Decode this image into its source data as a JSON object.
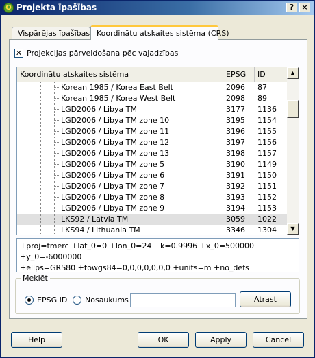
{
  "window": {
    "title": "Projekta īpašības",
    "help_glyph": "?",
    "close_glyph": "×",
    "icon": "qgis-icon"
  },
  "tabs": [
    {
      "label": "Vispārējas īpašības",
      "active": false
    },
    {
      "label": "Koordinātu atskaites sistēma (CRS)",
      "active": true
    }
  ],
  "reprojection": {
    "label": "Projekcijas pārveidošana pēc vajadzības",
    "checked": true,
    "check_glyph": "✕"
  },
  "crs_table": {
    "columns": [
      "Koordinātu atskaites sistēma",
      "EPSG",
      "ID"
    ],
    "rows": [
      {
        "name": "Korean 1985 / Korea East Belt",
        "epsg": "2096",
        "id": "87"
      },
      {
        "name": "Korean 1985 / Korea West Belt",
        "epsg": "2098",
        "id": "89"
      },
      {
        "name": "LGD2006 / Libya TM",
        "epsg": "3177",
        "id": "1136"
      },
      {
        "name": "LGD2006 / Libya TM zone 10",
        "epsg": "3195",
        "id": "1154"
      },
      {
        "name": "LGD2006 / Libya TM zone 11",
        "epsg": "3196",
        "id": "1155"
      },
      {
        "name": "LGD2006 / Libya TM zone 12",
        "epsg": "3197",
        "id": "1156"
      },
      {
        "name": "LGD2006 / Libya TM zone 13",
        "epsg": "3198",
        "id": "1157"
      },
      {
        "name": "LGD2006 / Libya TM zone 5",
        "epsg": "3190",
        "id": "1149"
      },
      {
        "name": "LGD2006 / Libya TM zone 6",
        "epsg": "3191",
        "id": "1150"
      },
      {
        "name": "LGD2006 / Libya TM zone 7",
        "epsg": "3192",
        "id": "1151"
      },
      {
        "name": "LGD2006 / Libya TM zone 8",
        "epsg": "3193",
        "id": "1152"
      },
      {
        "name": "LGD2006 / Libya TM zone 9",
        "epsg": "3194",
        "id": "1153"
      },
      {
        "name": "LKS92 / Latvia TM",
        "epsg": "3059",
        "id": "1022"
      },
      {
        "name": "LKS94 / Lithuania TM",
        "epsg": "3346",
        "id": "1304"
      }
    ],
    "selected_row": "LKS92 / Latvia TM"
  },
  "proj_string": "+proj=tmerc +lat_0=0 +lon_0=24 +k=0.9996 +x_0=500000 +y_0=-6000000\n+ellps=GRS80 +towgs84=0,0,0,0,0,0,0 +units=m +no_defs",
  "search": {
    "group_title": "Meklēt",
    "option_epsg": "EPSG ID",
    "option_name": "Nosaukums",
    "selected_option": "EPSG ID",
    "field_value": "",
    "find_button": "Atrast"
  },
  "buttons": {
    "help": "Help",
    "ok": "OK",
    "apply": "Apply",
    "cancel": "Cancel"
  }
}
